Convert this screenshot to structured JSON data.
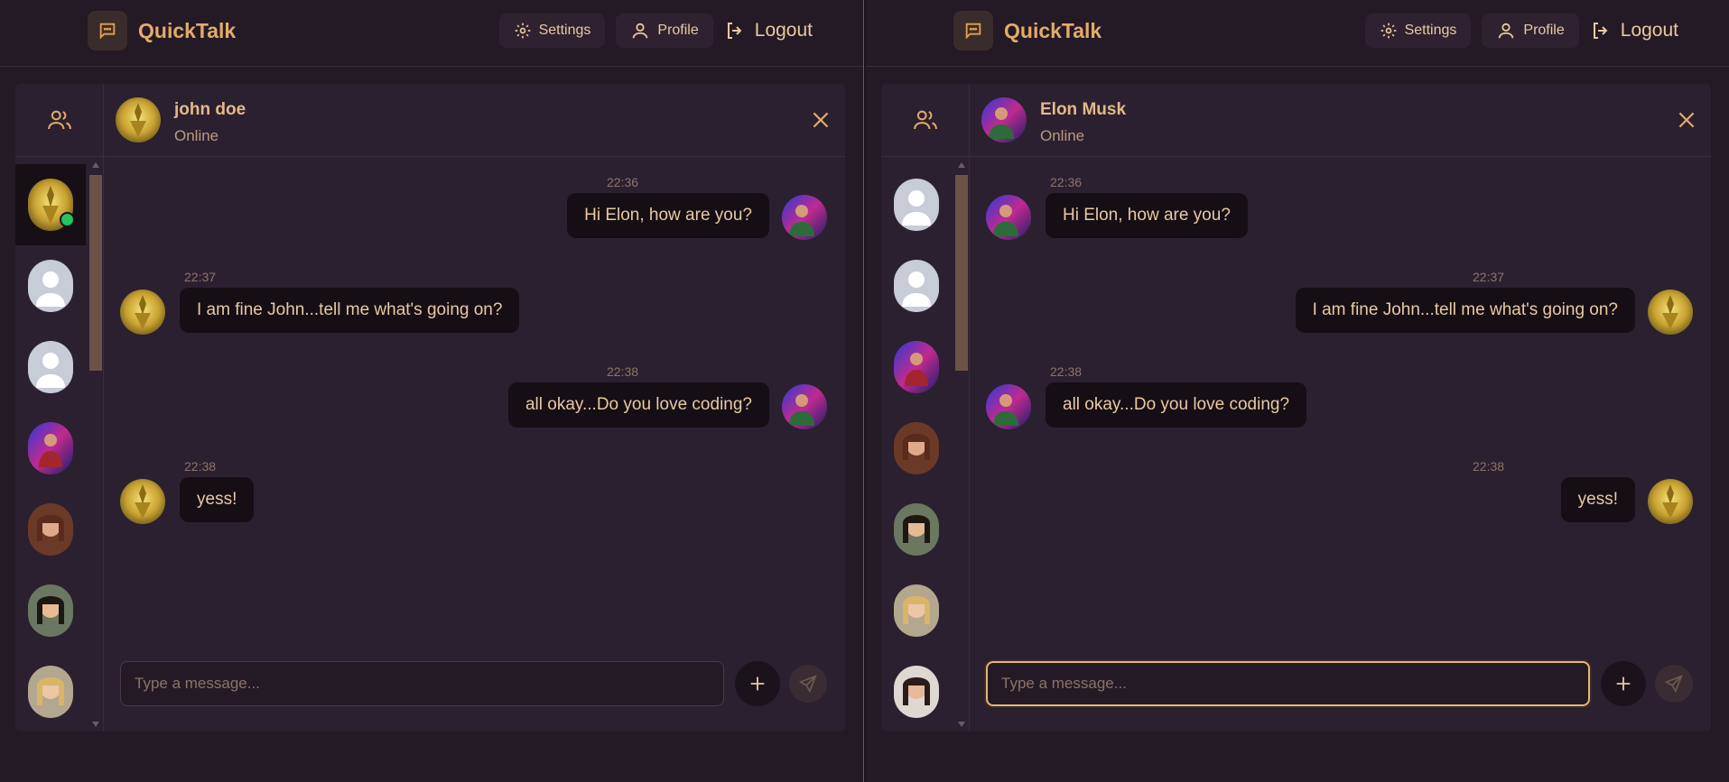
{
  "app": {
    "name": "QuickTalk"
  },
  "nav": {
    "settings": "Settings",
    "profile": "Profile",
    "logout": "Logout"
  },
  "colors": {
    "accent": "#e3ab69",
    "background": "#241a25",
    "panel": "#2b2030",
    "bubble": "#150e15",
    "online": "#22c55e"
  },
  "left": {
    "chat_with": {
      "name": "john doe",
      "status": "Online"
    },
    "messages": [
      {
        "time": "22:36",
        "text": "Hi Elon, how are you?",
        "side": "right"
      },
      {
        "time": "22:37",
        "text": "I am fine John...tell me what's going on?",
        "side": "left"
      },
      {
        "time": "22:38",
        "text": "all okay...Do you love coding?",
        "side": "right"
      },
      {
        "time": "22:38",
        "text": "yess!",
        "side": "left"
      }
    ],
    "input_placeholder": "Type a message..."
  },
  "right": {
    "chat_with": {
      "name": "Elon Musk",
      "status": "Online"
    },
    "messages": [
      {
        "time": "22:36",
        "text": "Hi Elon, how are you?",
        "side": "left"
      },
      {
        "time": "22:37",
        "text": "I am fine John...tell me what's going on?",
        "side": "right"
      },
      {
        "time": "22:38",
        "text": "all okay...Do you love coding?",
        "side": "left"
      },
      {
        "time": "22:38",
        "text": "yess!",
        "side": "right"
      }
    ],
    "input_placeholder": "Type a message..."
  }
}
